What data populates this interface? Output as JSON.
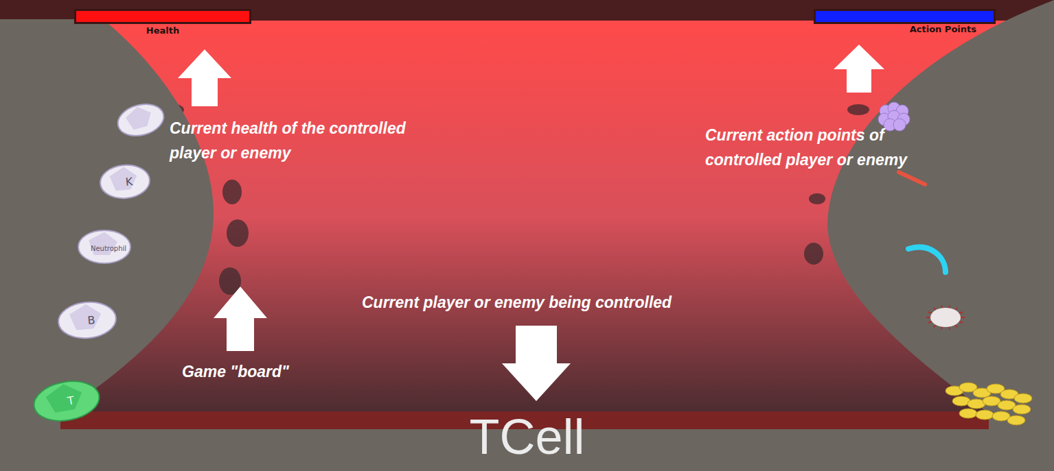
{
  "hud": {
    "health": {
      "label": "Health",
      "level": 1
    },
    "action_points": {
      "label": "Action Points",
      "level": 1
    }
  },
  "players": [
    {
      "label": "",
      "selected": false
    },
    {
      "label": "K",
      "selected": false
    },
    {
      "label": "Neutrophil",
      "selected": false
    },
    {
      "label": "B",
      "selected": false
    },
    {
      "label": "T",
      "selected": true
    }
  ],
  "enemies": [
    {
      "kind": "virus",
      "color": "#c6a6f2"
    },
    {
      "kind": "rod",
      "color": "#e8533f"
    },
    {
      "kind": "arc",
      "color": "#2ed3f2"
    },
    {
      "kind": "spiked",
      "color": "#ece6e6"
    },
    {
      "kind": "cluster",
      "color": "#f0d23c"
    }
  ],
  "annotations": [
    {
      "text": "Current health of the controlled player or enemy"
    },
    {
      "text": "Current action points of controlled player or enemy"
    },
    {
      "text": "Current player or enemy being controlled"
    },
    {
      "text": "Game \"board\""
    }
  ],
  "current_unit": {
    "label": "TCell"
  }
}
